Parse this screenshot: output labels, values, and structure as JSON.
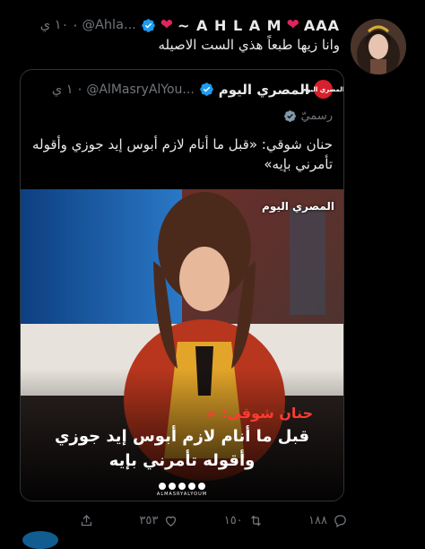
{
  "tweet": {
    "display_name": "AAA ❤️ A H L A M ~ ❤️",
    "display_name_text": "AAA",
    "display_name_second": "A H L A M ~",
    "handle": "@Ahla...",
    "time": "١٠ ي",
    "text": "وانا زيها طبعاً هذي الست الاصيله",
    "actions": {
      "replies": "١٨٨",
      "retweets": "١٥٠",
      "likes": "٣٥٣"
    }
  },
  "quote": {
    "logo_text": "المصري اليوم",
    "display_name": "المصري اليوم",
    "handle": "@AlMasryAlYou...",
    "time": "١ ي",
    "official_label": "رسميّ",
    "text": "حنان شوقي: «قبل ما أنام لازم أبوس إيد جوزي وأقوله تأمرني بإيه»",
    "media": {
      "brand": "المصري اليوم",
      "caption_name": "حنان شوقي:",
      "caption_line1": "قبل ما أنام لازم أبوس إيد جوزي",
      "caption_line2": "وأقوله تأمرني بإيه",
      "site": "ALMASRYALYOUM"
    }
  },
  "colors": {
    "background": "#000000",
    "text": "#e7e9ea",
    "secondary": "#71767b",
    "verified": "#1d9bf0",
    "heart": "#e0245e",
    "brand_red": "#d6202b"
  },
  "icons": [
    "verified-badge-icon",
    "heart-icon",
    "official-badge-icon",
    "reply-icon",
    "retweet-icon",
    "like-icon",
    "share-icon"
  ]
}
